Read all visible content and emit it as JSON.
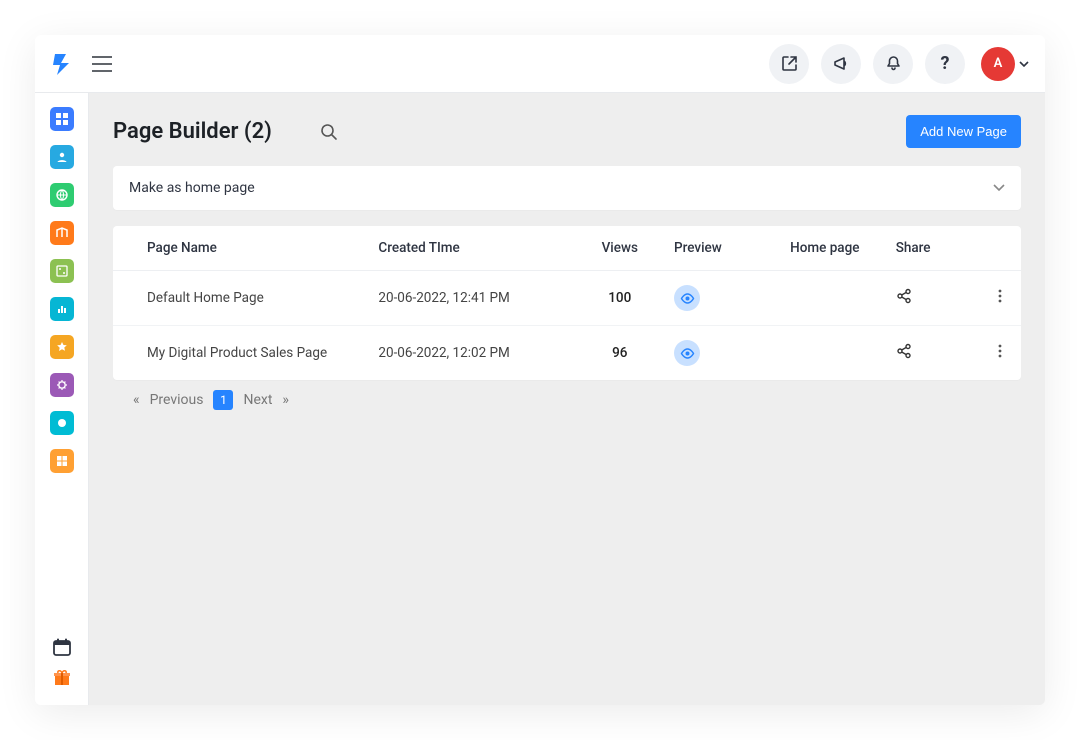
{
  "header": {
    "avatar_initial": "A"
  },
  "sidebar_colors": [
    "#3b7cff",
    "#27a9e1",
    "#2ecc71",
    "#ff7a1a",
    "#8cc152",
    "#06b6d4",
    "#f5a623",
    "#9b59b6",
    "#00bcd4",
    "#ffa033"
  ],
  "page": {
    "title": "Page Builder (2)",
    "add_label": "Add New Page",
    "panel_label": "Make as home page"
  },
  "table": {
    "columns": {
      "name": "Page Name",
      "created": "Created TIme",
      "views": "Views",
      "preview": "Preview",
      "home": "Home page",
      "share": "Share"
    },
    "rows": [
      {
        "name": "Default Home Page",
        "created": "20-06-2022, 12:41 PM",
        "views": "100"
      },
      {
        "name": "My Digital Product Sales Page",
        "created": "20-06-2022, 12:02 PM",
        "views": "96"
      }
    ]
  },
  "pager": {
    "prev": "Previous",
    "page": "1",
    "next": "Next",
    "laquo": "«",
    "raquo": "»"
  }
}
